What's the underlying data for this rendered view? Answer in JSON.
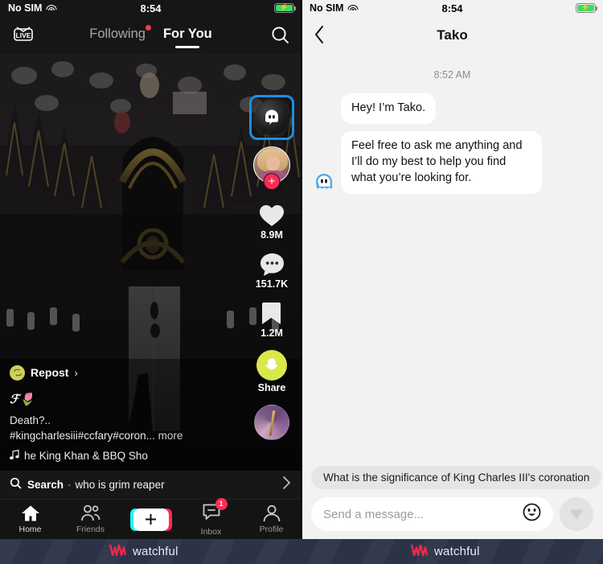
{
  "left": {
    "status": {
      "carrier": "No SIM",
      "time": "8:54",
      "wifi_icon": "wifi-icon",
      "battery_icon": "battery-charging-icon"
    },
    "top_tabs": {
      "live_label": "LIVE",
      "following_label": "Following",
      "foryou_label": "For You",
      "search_icon": "search-icon"
    },
    "rail": {
      "tako_icon": "tako-ghost-icon",
      "avatar_icon": "creator-avatar",
      "follow_label": "+",
      "like_icon": "heart-icon",
      "like_count": "8.9M",
      "comment_icon": "comment-bubble-icon",
      "comment_count": "151.7K",
      "bookmark_icon": "bookmark-icon",
      "bookmark_count": "1.2M",
      "share_icon": "snapchat-ghost-icon",
      "share_label": "Share",
      "album_icon": "spinning-record-icon"
    },
    "caption": {
      "repost_icon": "repost-icon",
      "repost_label": "Repost",
      "repost_chevron": "›",
      "username": "ℱ🌷",
      "desc_line1": "Death?..",
      "desc_line2": "#kingcharlesiii#ccfary#coron...",
      "more_label": "more",
      "music_icon": "music-note-icon",
      "music_title": "he King Khan & BBQ Sho"
    },
    "search_row": {
      "icon": "search-icon",
      "label": "Search",
      "separator": "·",
      "query": "who is grim reaper",
      "chevron_icon": "chevron-right-icon"
    },
    "bottom_nav": {
      "items": [
        {
          "label": "Home",
          "icon": "home-icon",
          "active": true
        },
        {
          "label": "Friends",
          "icon": "friends-icon",
          "active": false
        },
        {
          "label": "",
          "icon": "create-plus-icon",
          "active": false
        },
        {
          "label": "Inbox",
          "icon": "inbox-icon",
          "active": false,
          "badge": "1"
        },
        {
          "label": "Profile",
          "icon": "profile-icon",
          "active": false
        }
      ]
    }
  },
  "right": {
    "status": {
      "carrier": "No SIM",
      "time": "8:54",
      "wifi_icon": "wifi-icon",
      "battery_icon": "battery-charging-icon"
    },
    "header": {
      "back_icon": "chevron-left-icon",
      "title": "Tako"
    },
    "chat": {
      "timestamp": "8:52 AM",
      "messages": [
        {
          "sender": "bot",
          "text": "Hey! I’m Tako.",
          "avatar": false
        },
        {
          "sender": "bot",
          "text": "Feel free to ask me anything and I’ll do my best to help you find what you’re looking for.",
          "avatar": true
        }
      ]
    },
    "suggestion": "What is the significance of King Charles III's coronation",
    "composer": {
      "placeholder": "Send a message...",
      "emoji_icon": "emoji-smiley-icon",
      "send_icon": "send-paperplane-icon"
    }
  },
  "watermark": {
    "text": "watchful",
    "logo_icon": "watchful-logo-icon",
    "accent": "#f2264b",
    "bg": "#2c3347"
  },
  "colors": {
    "tiktok_red": "#fe2c55",
    "tiktok_cyan": "#25f4ee",
    "selection_blue": "#1a8fe3",
    "snapchat_yellow": "#d9e84a",
    "panel_dark": "#161616",
    "panel_light": "#f2f2f2"
  }
}
